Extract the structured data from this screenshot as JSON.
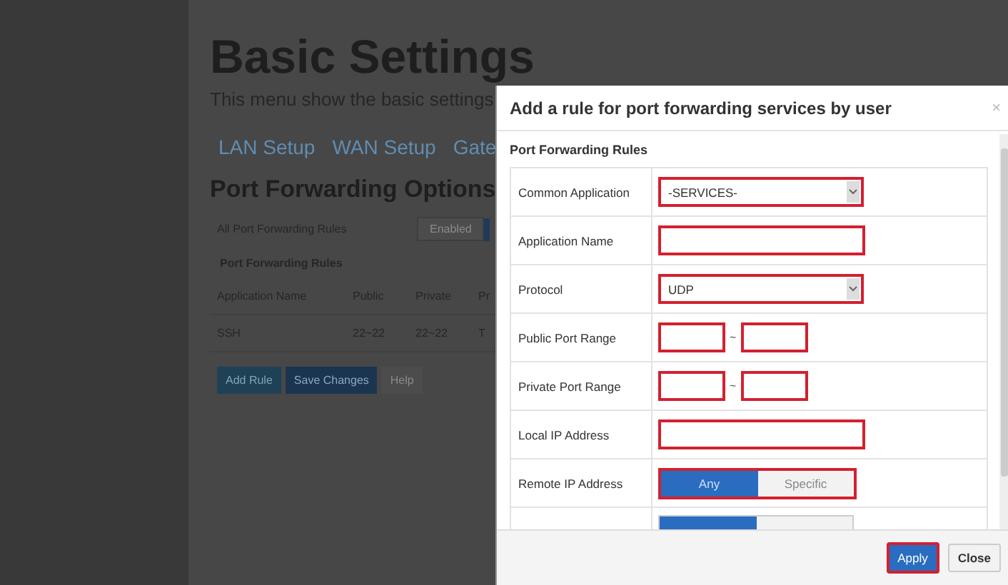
{
  "page": {
    "title": "Basic Settings",
    "subtitle": "This menu show the basic settings",
    "tabs": [
      {
        "label": "LAN Setup"
      },
      {
        "label": "WAN Setup"
      },
      {
        "label": "Gate"
      }
    ],
    "section_title": "Port Forwarding Options",
    "all_rules": {
      "label": "All Port Forwarding Rules",
      "button": "Enabled"
    },
    "rules_title": "Port Forwarding Rules",
    "table": {
      "columns": [
        "Application Name",
        "Public",
        "Private",
        "Pr"
      ],
      "rows": [
        [
          "SSH",
          "22~22",
          "22~22",
          "T"
        ]
      ]
    },
    "buttons": [
      {
        "label": "Add Rule",
        "kind": "secondary"
      },
      {
        "label": "Save Changes",
        "kind": "primary"
      },
      {
        "label": "Help",
        "kind": "plain"
      }
    ]
  },
  "dialog": {
    "title": "Add a rule for port forwarding services by user",
    "close_icon": "×",
    "section_title": "Port Forwarding Rules",
    "rows": [
      {
        "kind": "select",
        "label": "Common Application",
        "value": "-SERVICES-",
        "highlighted": true
      },
      {
        "kind": "text",
        "label": "Application Name",
        "highlighted": true
      },
      {
        "kind": "select",
        "label": "Protocol",
        "value": "UDP",
        "highlighted": true
      },
      {
        "kind": "range",
        "label": "Public Port Range",
        "separator": "~",
        "highlighted": true
      },
      {
        "kind": "range",
        "label": "Private Port Range",
        "separator": "~",
        "highlighted": true
      },
      {
        "kind": "text",
        "label": "Local IP Address",
        "highlighted": true
      },
      {
        "kind": "toggle",
        "label": "Remote IP Address",
        "highlighted": true,
        "options": [
          {
            "label": "Any",
            "selected": true
          },
          {
            "label": "Specific",
            "selected": false
          }
        ]
      },
      {
        "kind": "toggle",
        "options": [
          {
            "selected": true
          },
          {
            "selected": false
          }
        ]
      }
    ],
    "buttons": [
      {
        "label": "Apply",
        "kind": "primary",
        "highlighted": true
      },
      {
        "label": "Close",
        "kind": "plain",
        "highlighted": false
      }
    ]
  }
}
